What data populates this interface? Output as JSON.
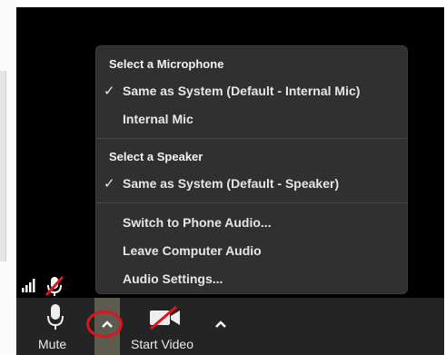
{
  "menu": {
    "microphone_header": "Select a Microphone",
    "mic_items": [
      {
        "label": "Same as System (Default - Internal Mic)",
        "checked": true
      },
      {
        "label": "Internal Mic",
        "checked": false
      }
    ],
    "speaker_header": "Select a Speaker",
    "speaker_items": [
      {
        "label": "Same as System (Default - Speaker)",
        "checked": true
      }
    ],
    "actions": [
      {
        "label": "Switch to Phone Audio..."
      },
      {
        "label": "Leave Computer Audio"
      },
      {
        "label": "Audio Settings..."
      }
    ],
    "check_glyph": "✓"
  },
  "toolbar": {
    "mute_label": "Mute",
    "start_video_label": "Start Video",
    "mic_icon": "microphone-icon",
    "video_icon": "video-off-icon",
    "caret_icon": "chevron-up-icon",
    "audio_caret_highlighted": true
  },
  "status": {
    "signal_icon": "signal-bars-icon",
    "muted_icon": "muted-mic-icon"
  },
  "colors": {
    "video_bg": "#000000",
    "toolbar_bg": "#242424",
    "menu_bg": "#303030",
    "menu_text": "#e6e6e6",
    "muted_red": "#e0141c",
    "highlight": "#5d5a4e"
  }
}
